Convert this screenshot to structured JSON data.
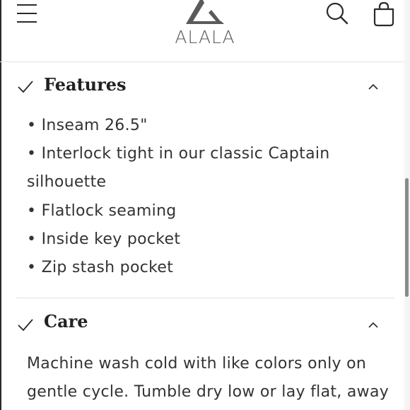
{
  "header": {
    "brand": "ALALA"
  },
  "features": {
    "title": "Features",
    "items": [
      "• Inseam 26.5\"",
      "• Interlock tight in our classic Captain silhouette",
      "• Flatlock seaming",
      "• Inside key pocket",
      "• Zip stash pocket"
    ]
  },
  "care": {
    "title": "Care",
    "text": "Machine wash cold with like colors only on gentle cycle. Tumble dry low or lay flat, away"
  },
  "icons": {
    "menu": "hamburger-menu-icon",
    "logo": "alala-logo-mark",
    "search": "search-icon",
    "cart": "shopping-bag-icon",
    "check": "checkmark-icon",
    "caret": "chevron-up-icon"
  },
  "colors": {
    "text": "#222222",
    "logo": "#5a5a5a",
    "divider": "#e0e0e0",
    "background": "#ffffff"
  }
}
